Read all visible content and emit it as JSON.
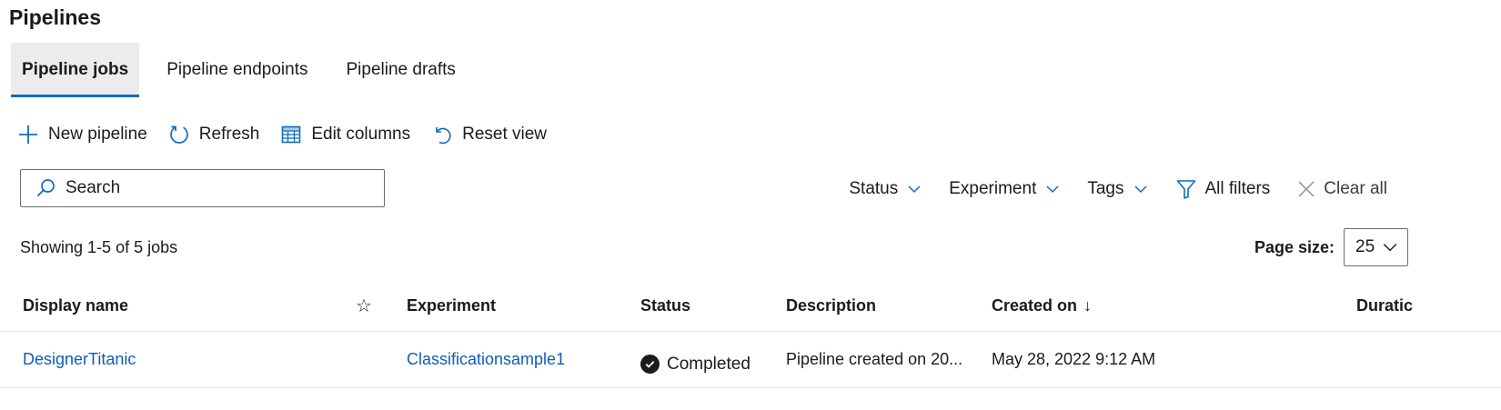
{
  "page": {
    "title": "Pipelines"
  },
  "tabs": [
    {
      "label": "Pipeline jobs",
      "active": true
    },
    {
      "label": "Pipeline endpoints",
      "active": false
    },
    {
      "label": "Pipeline drafts",
      "active": false
    }
  ],
  "toolbar": {
    "new_pipeline": {
      "label": "New pipeline",
      "icon": "plus-icon"
    },
    "refresh": {
      "label": "Refresh",
      "icon": "refresh-icon"
    },
    "edit_columns": {
      "label": "Edit columns",
      "icon": "table-columns-icon"
    },
    "reset_view": {
      "label": "Reset view",
      "icon": "reset-icon"
    }
  },
  "search": {
    "placeholder": "Search",
    "value": "",
    "icon": "search-icon"
  },
  "filters": {
    "status": "Status",
    "experiment": "Experiment",
    "tags": "Tags",
    "all_filters": "All filters",
    "clear_all": "Clear all"
  },
  "results": {
    "showing": "Showing 1-5 of 5 jobs"
  },
  "page_size": {
    "label": "Page size:",
    "value": "25"
  },
  "table": {
    "columns": {
      "display_name": "Display name",
      "favorite": "☆",
      "experiment": "Experiment",
      "status": "Status",
      "description": "Description",
      "created_on": "Created on",
      "sort_indicator": "↓",
      "duration": "Duratic"
    },
    "rows": [
      {
        "display_name": "DesignerTitanic",
        "experiment": "Classificationsample1",
        "status": "Completed",
        "description": "Pipeline created on 20...",
        "created_on": "May 28, 2022 9:12 AM"
      }
    ]
  },
  "colors": {
    "accent": "#0f6cbd",
    "link": "#0f5cb8",
    "border": "#6d6d6d",
    "tab_bg": "#ececec"
  }
}
